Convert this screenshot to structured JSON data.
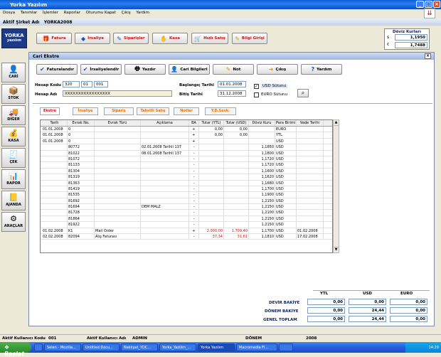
{
  "window": {
    "title": "Yorka Yazılım"
  },
  "menu": [
    "Dosya",
    "Tanımlar",
    "İşlemler",
    "Raporlar",
    "Oturumu Kapat",
    "Çıkış",
    "Yardım"
  ],
  "company": {
    "label": "Aktif Şirket Adı",
    "value": "YORKA2008"
  },
  "logo": {
    "line1": "YORKA",
    "line2": "yazılım"
  },
  "toolbar": [
    {
      "label": "Fatura",
      "icon": "gift-icon"
    },
    {
      "label": "İrsaliye",
      "icon": "diamond-icon"
    },
    {
      "label": "Siparişler",
      "icon": "pencil-icon"
    },
    {
      "label": "Kasa",
      "icon": "handshake-icon"
    },
    {
      "label": "Hızlı Satış",
      "icon": "cart-icon"
    },
    {
      "label": "Bilgi Girişi",
      "icon": "pencil-icon"
    }
  ],
  "doviz": {
    "title": "Döviz Kurları",
    "usd_symbol": "$",
    "usd": "1,1950",
    "eur_symbol": "€",
    "eur": "1,7488"
  },
  "sidebar": [
    "CARİ",
    "STOK",
    "DİĞER",
    "KASA",
    "ÇEK",
    "RAPOR",
    "AJANDA",
    "ARAÇLAR"
  ],
  "cari": {
    "title": "Cari Ekstre",
    "buttons": [
      {
        "label": "Faturalandır",
        "icon": "checkmark-icon"
      },
      {
        "label": "İrsaliyelendir",
        "icon": "checkmark-icon"
      },
      {
        "label": "Yazdır",
        "icon": "printer-icon"
      },
      {
        "label": "Cari Bilgileri",
        "icon": "person-icon"
      },
      {
        "label": "Not",
        "icon": "note-icon"
      },
      {
        "label": "Çıkış",
        "icon": "exit-icon"
      },
      {
        "label": "Yardım",
        "icon": "help-icon"
      }
    ],
    "hesap_kodu_label": "Hesap Kodu",
    "hesap_kodu": [
      "320",
      "01",
      "001"
    ],
    "hesap_adi_label": "Hesap Adı",
    "hesap_adi": "XXXXXXXXXXXXXXXXX",
    "baslangic_label": "Başlangıç Tarihi",
    "baslangic": "01.01.2008",
    "bitis_label": "Bitiş Tarihi",
    "bitis": "31.12.2008",
    "usd_label": "USD Sütunu",
    "euro_label": "EURO Sütunu"
  },
  "tabs": [
    "Ekstre",
    "İrsaliye",
    "Sipariş",
    "Tahsilli Satış",
    "Notlar",
    "Y.D.Sevk."
  ],
  "columns": [
    "Tarih",
    "Evrak No.",
    "Evrak Türü",
    "Açıklama",
    "BA",
    "Tutar (YTL)",
    "Tutar (USD)",
    "Döviz Kuru",
    "Para Birimi",
    "Vade Tarihi"
  ],
  "rows": [
    [
      "01.01.2008",
      "0",
      "",
      "",
      "+",
      "0,00",
      "0,00",
      "",
      "EURO",
      ""
    ],
    [
      "01.01.2008",
      "0",
      "",
      "",
      "+",
      "0,00",
      "0,00",
      "",
      "YTL",
      ""
    ],
    [
      "01.01.2008",
      "0",
      "",
      "",
      "+",
      "",
      "",
      "",
      "USD",
      ""
    ],
    [
      "",
      "80772",
      "",
      "02.01.2008 Tarihli 137",
      "-",
      "",
      "",
      "1,1850",
      "USD",
      ""
    ],
    [
      "",
      "81022",
      "",
      "08.01.2008 Tarihli 137",
      "-",
      "",
      "",
      "1,1800",
      "USD",
      ""
    ],
    [
      "",
      "81072",
      "",
      "",
      "-",
      "",
      "",
      "1,1720",
      "USD",
      ""
    ],
    [
      "",
      "81133",
      "",
      "",
      "-",
      "",
      "",
      "1,1720",
      "USD",
      ""
    ],
    [
      "",
      "81304",
      "",
      "",
      "-",
      "",
      "",
      "1,1600",
      "USD",
      ""
    ],
    [
      "",
      "81319",
      "",
      "",
      "-",
      "",
      "",
      "1,1620",
      "USD",
      ""
    ],
    [
      "",
      "81363",
      "",
      "",
      "-",
      "",
      "",
      "1,1680",
      "USD",
      ""
    ],
    [
      "",
      "81419",
      "",
      "",
      "-",
      "",
      "",
      "1,1700",
      "USD",
      ""
    ],
    [
      "",
      "81535",
      "",
      "",
      "-",
      "",
      "",
      "1,1900",
      "USD",
      ""
    ],
    [
      "",
      "81692",
      "",
      "",
      "-",
      "",
      "",
      "1,2150",
      "USD",
      ""
    ],
    [
      "",
      "81694",
      "",
      "DEM MALZ",
      "-",
      "",
      "",
      "1,2150",
      "USD",
      ""
    ],
    [
      "",
      "81728",
      "",
      "",
      "-",
      "",
      "",
      "1,2100",
      "USD",
      ""
    ],
    [
      "",
      "81864",
      "",
      "",
      "-",
      "",
      "",
      "1,2150",
      "USD",
      ""
    ],
    [
      "",
      "81922",
      "",
      "",
      "-",
      "",
      "",
      "1,2150",
      "USD",
      ""
    ],
    [
      "01.02.2008",
      "K1",
      "Mail Order",
      "",
      "+",
      "2.000,00",
      "1.709,40",
      "1,1700",
      "USD",
      "01.02.2008"
    ],
    [
      "02.02.2008",
      "82094",
      "Alış Faturası",
      "",
      "-",
      "37,34",
      "31,61",
      "1,1810",
      "USD",
      "17.02.2008"
    ]
  ],
  "totals": {
    "headers": [
      "YTL",
      "USD",
      "EURO"
    ],
    "rows": [
      {
        "label": "DEVİR BAKİYE",
        "values": [
          "0,00",
          "0,00",
          "0,00"
        ]
      },
      {
        "label": "DÖNEM BAKİYE",
        "values": [
          "0,00",
          "24,44",
          "0,00"
        ]
      },
      {
        "label": "GENEL TOPLAM",
        "values": [
          "0,00",
          "24,44",
          "0,00"
        ]
      }
    ]
  },
  "status": {
    "user_code_label": "Aktif Kullanıcı Kodu",
    "user_code": "001",
    "user_name_label": "Aktif Kullanıcı Adı",
    "user_name": "ADMIN",
    "donem_label": "DÖNEM",
    "donem": "2008"
  },
  "taskbar": {
    "start": "Başlat",
    "tasks": [
      "",
      "Selen - Mozilla...",
      "Untitled Docu...",
      "Nakliyat_YDC...",
      "Yorka_Yazilim_...",
      "Yorka Yazılım",
      "Macromedia Fi...",
      ""
    ],
    "clock": "14:29"
  },
  "colors": {
    "title_blue": "#0a5fd8",
    "menu_red": "#c01616",
    "accent_orange": "#e07010"
  }
}
